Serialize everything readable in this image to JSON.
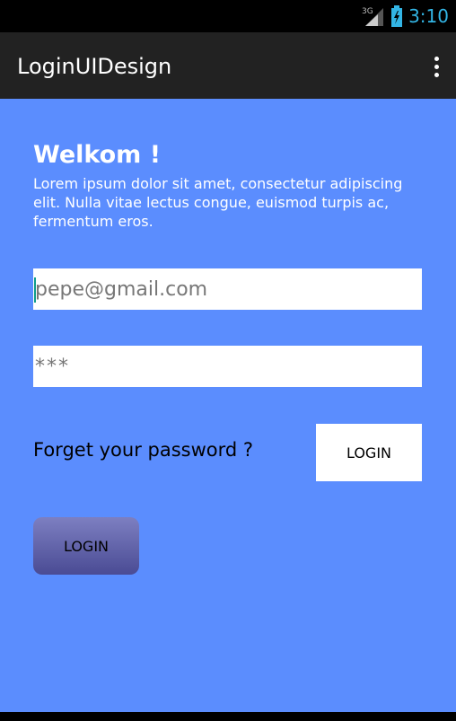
{
  "status_bar": {
    "network_label": "3G",
    "time": "3:10",
    "accent_color": "#33b5e5"
  },
  "action_bar": {
    "title": "LoginUIDesign",
    "overflow_icon": "more-vert-icon"
  },
  "main": {
    "background_color": "#5b8dfe",
    "welcome_title": "Welkom !",
    "welcome_text": "Lorem ipsum dolor sit amet, consectetur adipiscing elit. Nulla vitae lectus congue, euismod turpis ac, fermentum eros.",
    "email": {
      "value": "",
      "placeholder": "pepe@gmail.com"
    },
    "password": {
      "value": "",
      "placeholder": "***"
    },
    "forgot_password_label": "Forget your password ?",
    "login_button_label": "LOGIN",
    "login_gradient_button_label": "LOGIN"
  }
}
